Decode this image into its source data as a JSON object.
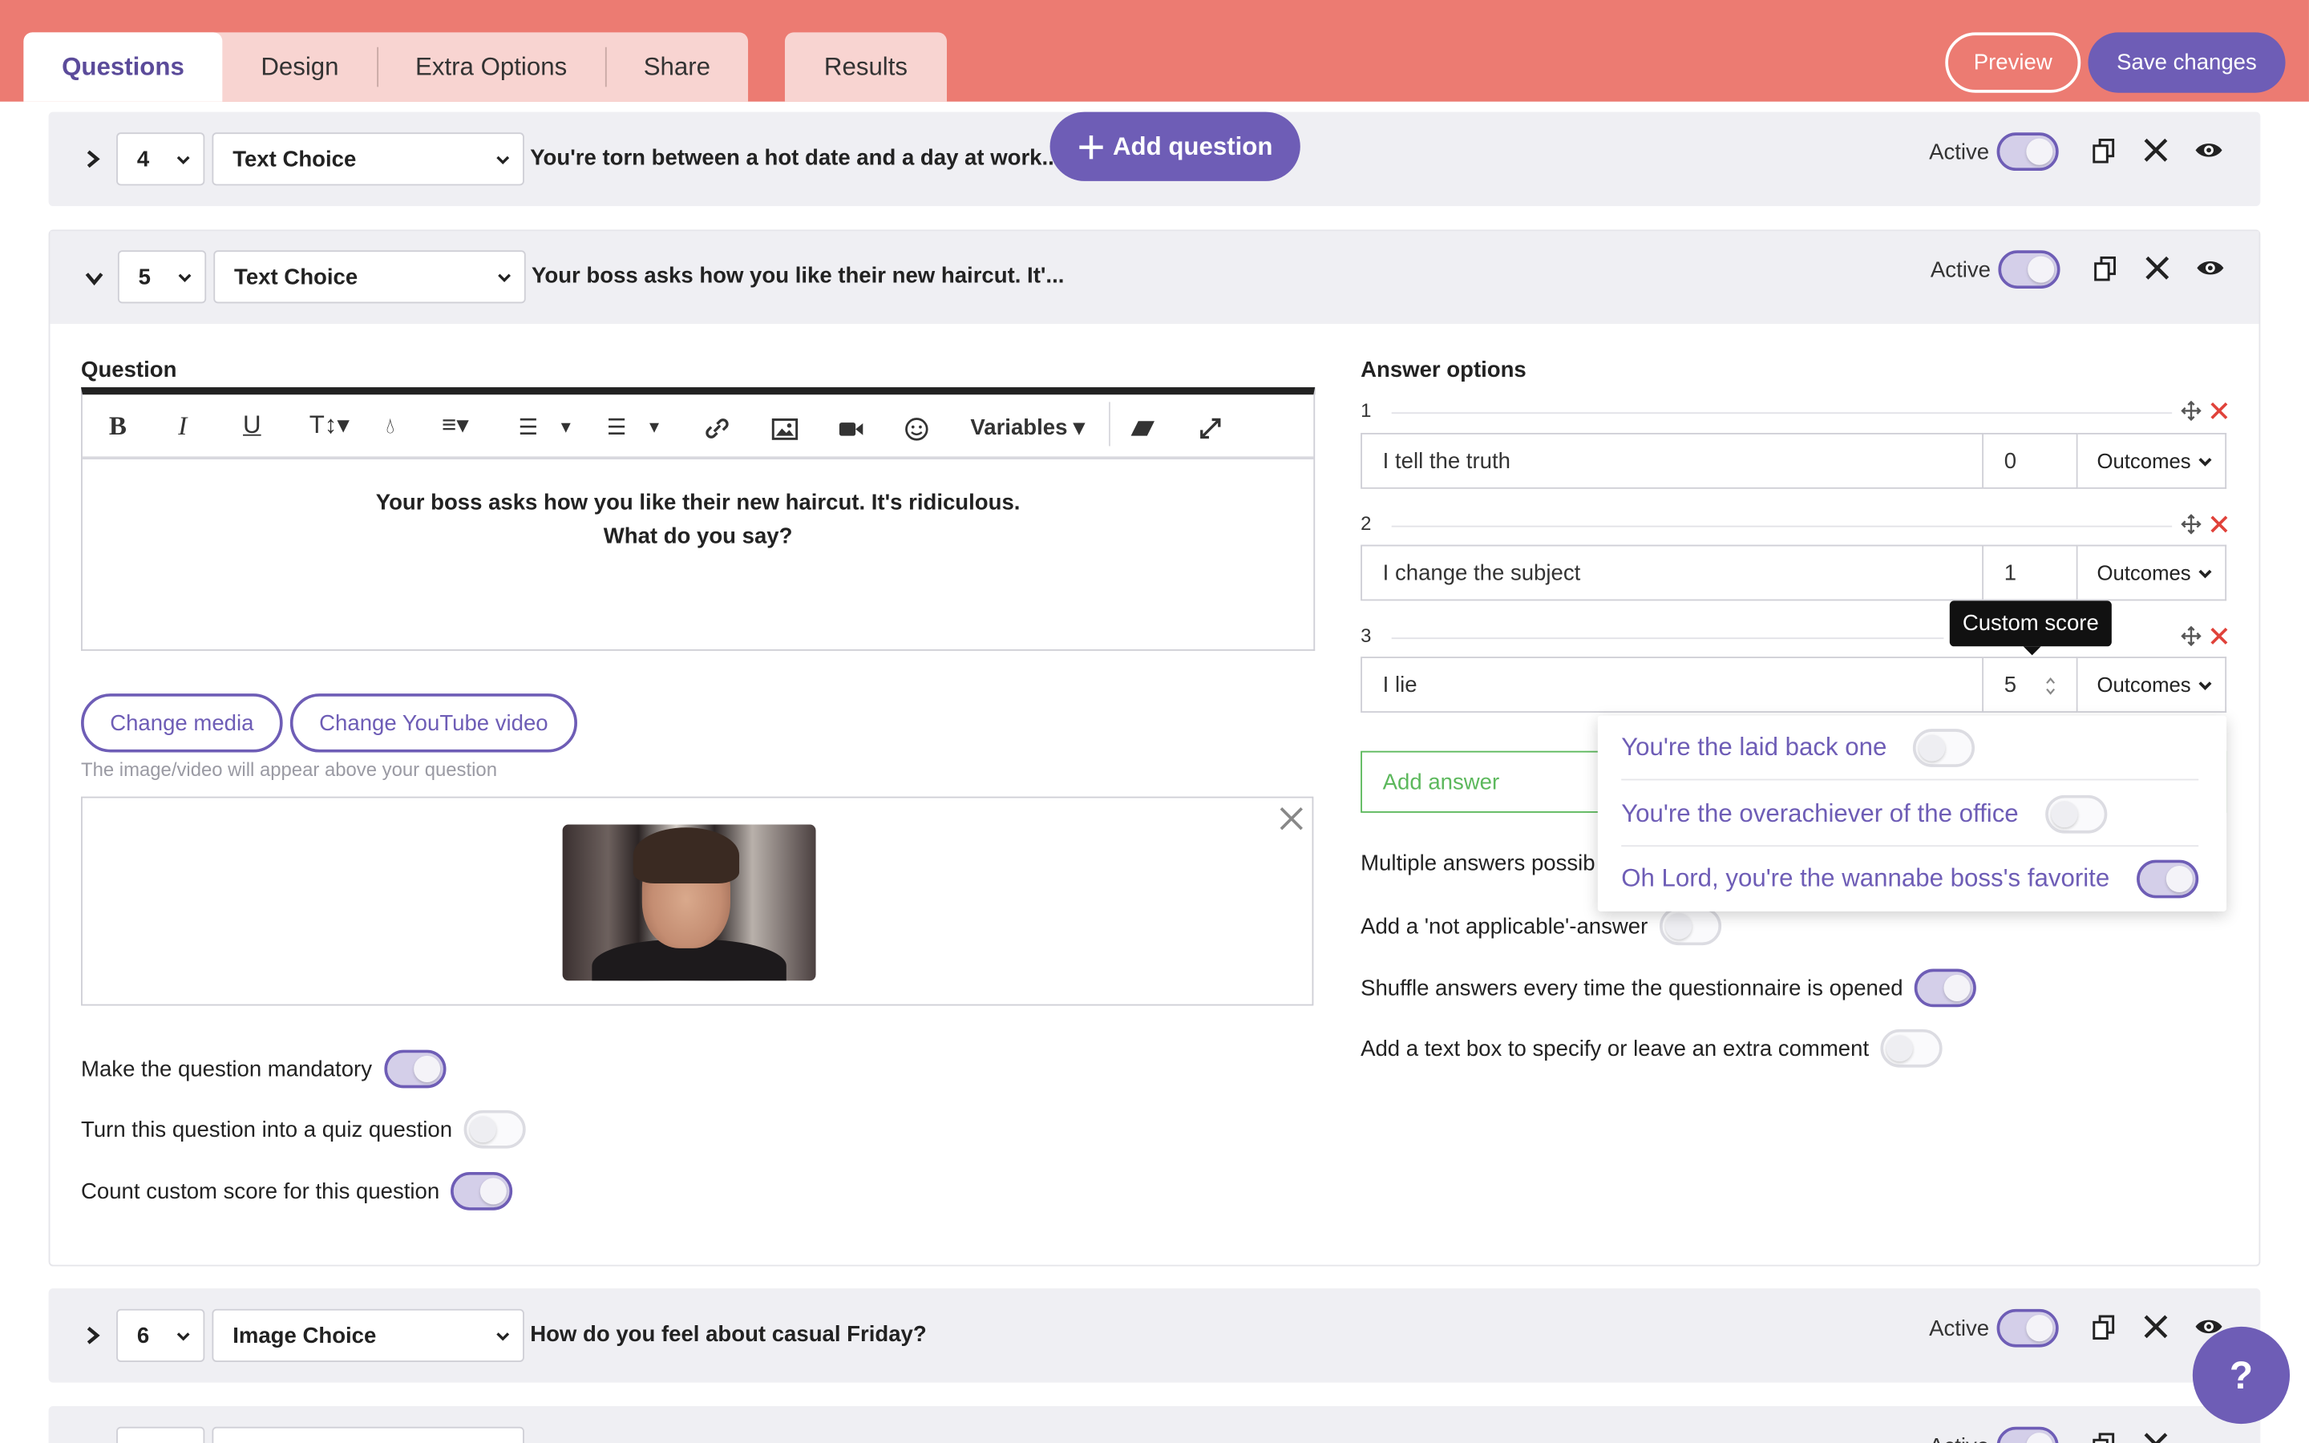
{
  "tabs": [
    "Questions",
    "Design",
    "Extra Options",
    "Share"
  ],
  "results_tab": "Results",
  "header": {
    "preview": "Preview",
    "save": "Save changes"
  },
  "add_question": "Add question",
  "rows": [
    {
      "num": "4",
      "type": "Text Choice",
      "title": "You're torn between a hot date and a day at work....",
      "active": "Active"
    },
    {
      "num": "5",
      "type": "Text Choice",
      "title": "Your boss asks how you like their new haircut. It'...",
      "active": "Active"
    },
    {
      "num": "6",
      "type": "Image Choice",
      "title": "How do you feel about casual Friday?",
      "active": "Active"
    },
    {
      "num": "",
      "type": "",
      "title": "",
      "active": "Active"
    }
  ],
  "question": {
    "label": "Question",
    "variables": "Variables",
    "text_line1": "Your boss asks how you like their new haircut. It's ridiculous.",
    "text_line2": "What do you say?",
    "change_media": "Change media",
    "change_youtube": "Change YouTube video",
    "media_hint": "The image/video will appear above your question",
    "options": [
      {
        "label": "Make the question mandatory",
        "on": true
      },
      {
        "label": "Turn this question into a quiz question",
        "on": false
      },
      {
        "label": "Count custom score for this question",
        "on": true
      }
    ]
  },
  "answers": {
    "label": "Answer options",
    "items": [
      {
        "num": "1",
        "text": "I tell the truth",
        "score": "0",
        "outcomes": "Outcomes"
      },
      {
        "num": "2",
        "text": "I change the subject",
        "score": "1",
        "outcomes": "Outcomes"
      },
      {
        "num": "3",
        "text": "I lie",
        "score": "5",
        "outcomes": "Outcomes"
      }
    ],
    "tooltip": "Custom score",
    "add_answer": "Add answer",
    "multiple_partial": "Multiple answers possib",
    "options": [
      {
        "label": "Add a 'not applicable'-answer",
        "on": false
      },
      {
        "label": "Shuffle answers every time the questionnaire is opened",
        "on": true
      },
      {
        "label": "Add a text box to specify or leave an extra comment",
        "on": false
      }
    ]
  },
  "outcomes_dropdown": [
    {
      "label": "You're the laid back one",
      "on": false
    },
    {
      "label": "You're the overachiever of the office",
      "on": false
    },
    {
      "label": "Oh Lord, you're the wannabe boss's favorite",
      "on": true
    }
  ],
  "help": "?",
  "colors": {
    "header": "#ec7b72",
    "accent": "#6e5db6",
    "add_answer": "#5cb85c",
    "delete": "#e0423a"
  }
}
